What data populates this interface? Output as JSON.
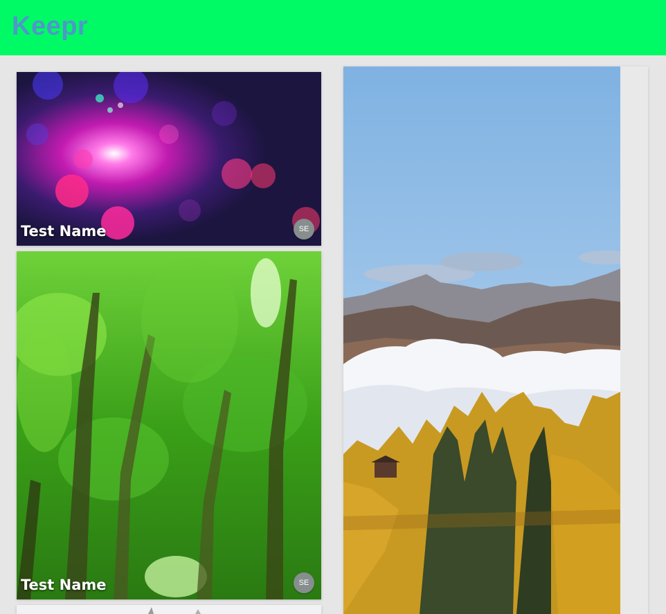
{
  "navbar": {
    "brand": "Keepr",
    "color": "#00fa66",
    "brand_color": "#4e98c8"
  },
  "keeps": [
    {
      "name": "Test Name",
      "creator_initials": "SE",
      "image": "fiber-optic-lights"
    },
    {
      "name": "Test Name",
      "creator_initials": "SE",
      "image": "forest-canopy"
    },
    {
      "image": "mountains-clouds-autumn-trees"
    },
    {
      "image": "snowy-tree"
    }
  ]
}
